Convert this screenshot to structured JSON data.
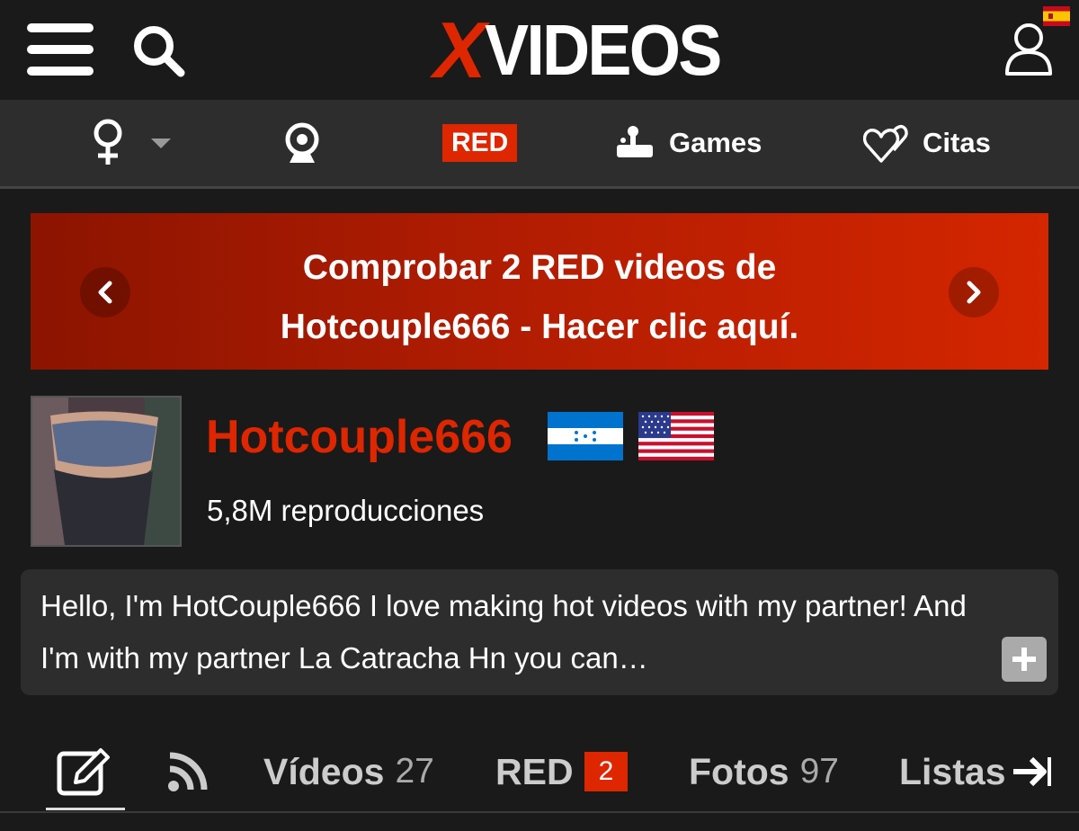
{
  "header": {
    "logo_x": "X",
    "logo_text": "VIDEOS",
    "language_flag": "es"
  },
  "icons": {
    "menu": "hamburger-icon",
    "search": "search-icon",
    "user": "user-icon",
    "gender": "female-icon",
    "cams": "webcam-icon",
    "games": "joystick-icon",
    "dating": "hearts-icon",
    "edit": "edit-icon",
    "feed": "rss-icon",
    "more": "arrow-right-icon"
  },
  "nav": {
    "red_label": "RED",
    "games_label": "Games",
    "citas_label": "Citas"
  },
  "banner": {
    "line1": "Comprobar 2 RED videos de",
    "line2": "Hotcouple666 - Hacer clic aquí."
  },
  "profile": {
    "name": "Hotcouple666",
    "views": "5,8M reproducciones",
    "flags": [
      "Honduras",
      "United States"
    ]
  },
  "bio": {
    "text": "Hello, I'm HotCouple666 I love making hot videos with my partner! And I'm with my partner La Catracha Hn you can…",
    "expand_label": "+"
  },
  "tabs": {
    "videos_label": "Vídeos",
    "videos_count": "27",
    "red_label": "RED",
    "red_count": "2",
    "fotos_label": "Fotos",
    "fotos_count": "97",
    "listas_label": "Listas"
  },
  "colors": {
    "brand_red": "#de2600",
    "background": "#1a1a1a",
    "nav_bg": "#2d2d2d"
  }
}
